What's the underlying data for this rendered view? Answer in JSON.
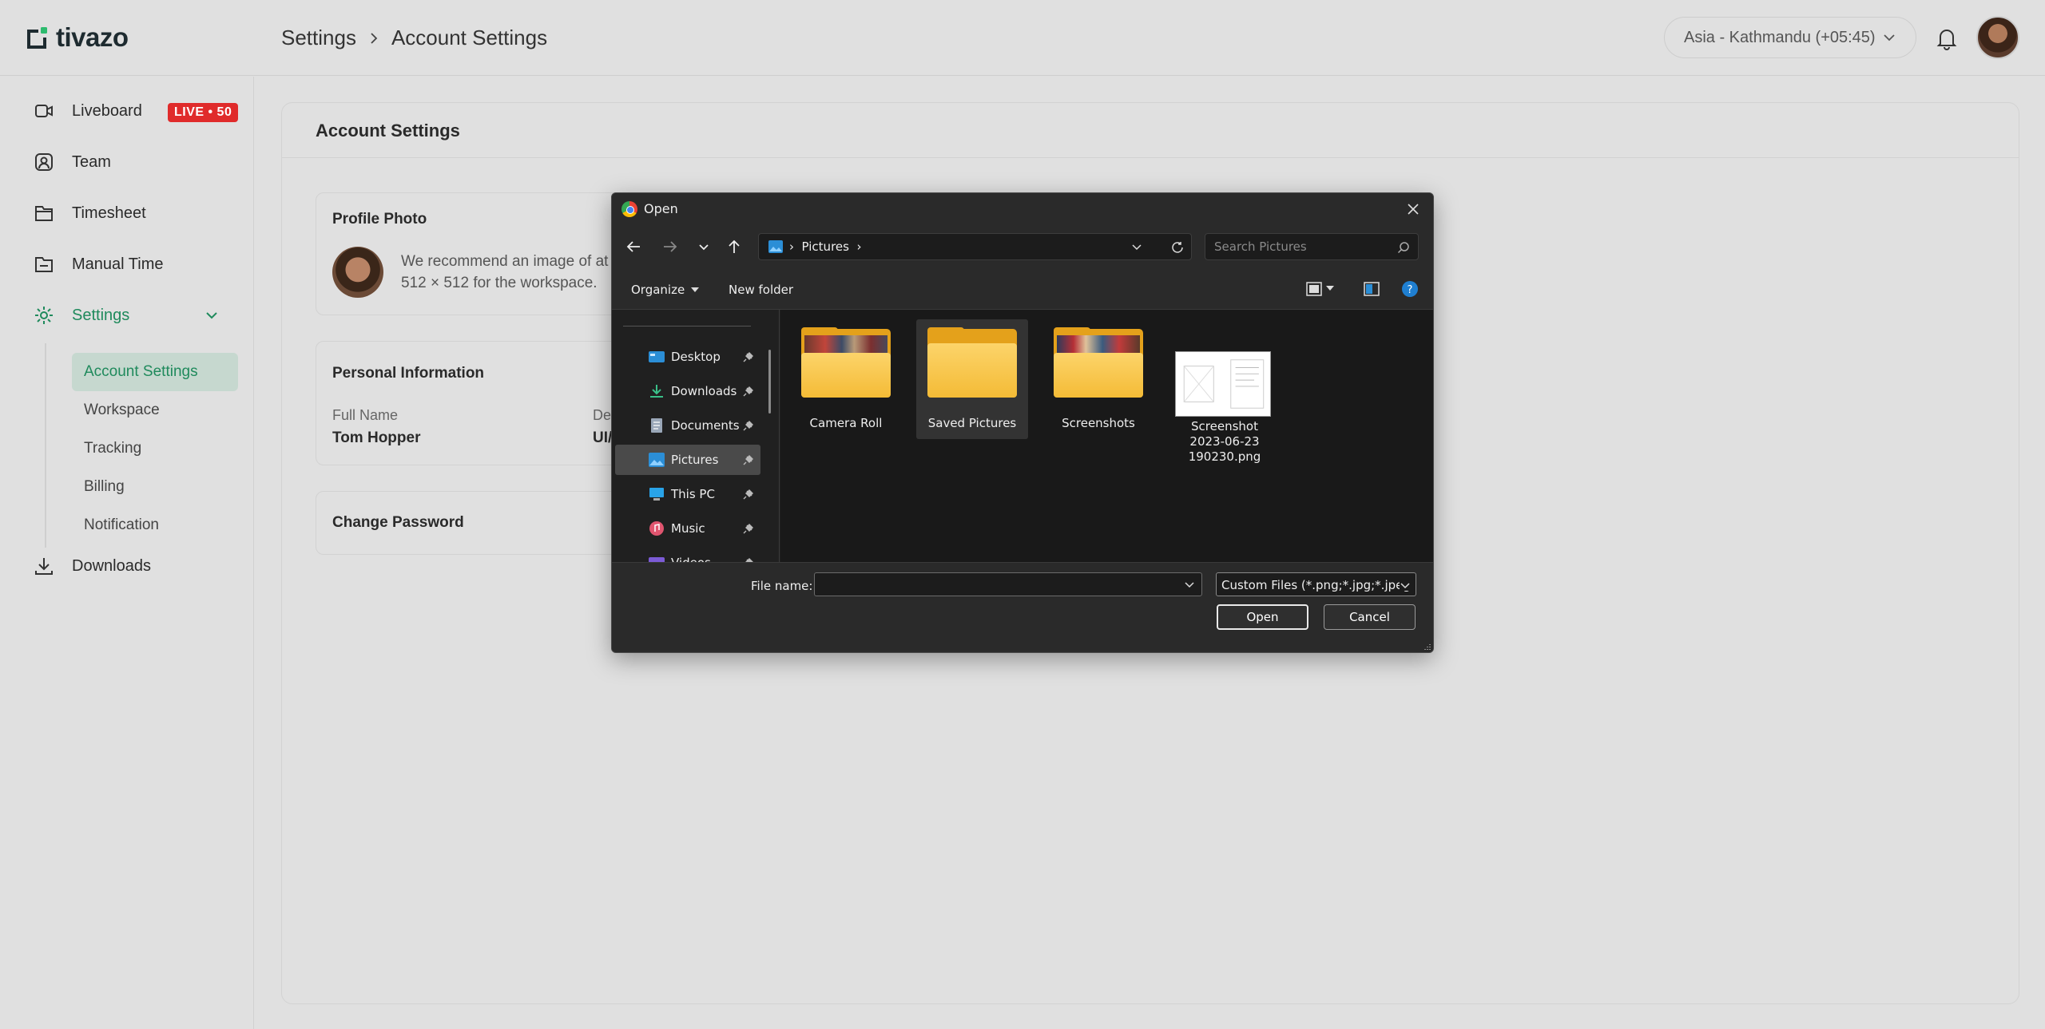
{
  "app": {
    "logo_text": "tivazo",
    "brand_color": "#1f8a5c"
  },
  "header": {
    "breadcrumb": [
      "Settings",
      "Account Settings"
    ],
    "timezone": "Asia - Kathmandu (+05:45)"
  },
  "sidebar": {
    "items": [
      {
        "label": "Liveboard",
        "icon": "video-icon",
        "badge": "LIVE • 50"
      },
      {
        "label": "Team",
        "icon": "user-square-icon"
      },
      {
        "label": "Timesheet",
        "icon": "timesheet-icon"
      },
      {
        "label": "Manual Time",
        "icon": "manual-time-icon"
      },
      {
        "label": "Settings",
        "icon": "gear-icon",
        "active": true
      },
      {
        "label": "Downloads",
        "icon": "download-icon"
      }
    ],
    "settings_sub": [
      "Account Settings",
      "Workspace",
      "Tracking",
      "Billing",
      "Notification"
    ]
  },
  "main": {
    "title": "Account Settings",
    "profile_photo": {
      "title": "Profile Photo",
      "recommend_line1": "We recommend an image of at",
      "recommend_line2": "512 × 512 for the workspace."
    },
    "personal_info": {
      "title": "Personal Information",
      "full_name_label": "Full Name",
      "full_name_value": "Tom Hopper",
      "second_label": "De",
      "second_value": "UI/"
    },
    "change_password": {
      "title": "Change Password"
    }
  },
  "dialog": {
    "title": "Open",
    "address": "Pictures",
    "search_placeholder": "Search Pictures",
    "organize_label": "Organize",
    "new_folder_label": "New folder",
    "nav_pane": [
      "Desktop",
      "Downloads",
      "Documents",
      "Pictures",
      "This PC",
      "Music",
      "Videos"
    ],
    "files": [
      {
        "name": "Camera Roll",
        "kind": "folder-photo"
      },
      {
        "name": "Saved Pictures",
        "kind": "folder"
      },
      {
        "name": "Screenshots",
        "kind": "folder-photo"
      },
      {
        "name_line1": "Screenshot",
        "name_line2": "2023-06-23",
        "name_line3": "190230.png",
        "kind": "image"
      }
    ],
    "file_name_label": "File name:",
    "file_name_value": "",
    "file_type": "Custom Files (*.png;*.jpg;*.jpeg",
    "open_label": "Open",
    "cancel_label": "Cancel"
  }
}
